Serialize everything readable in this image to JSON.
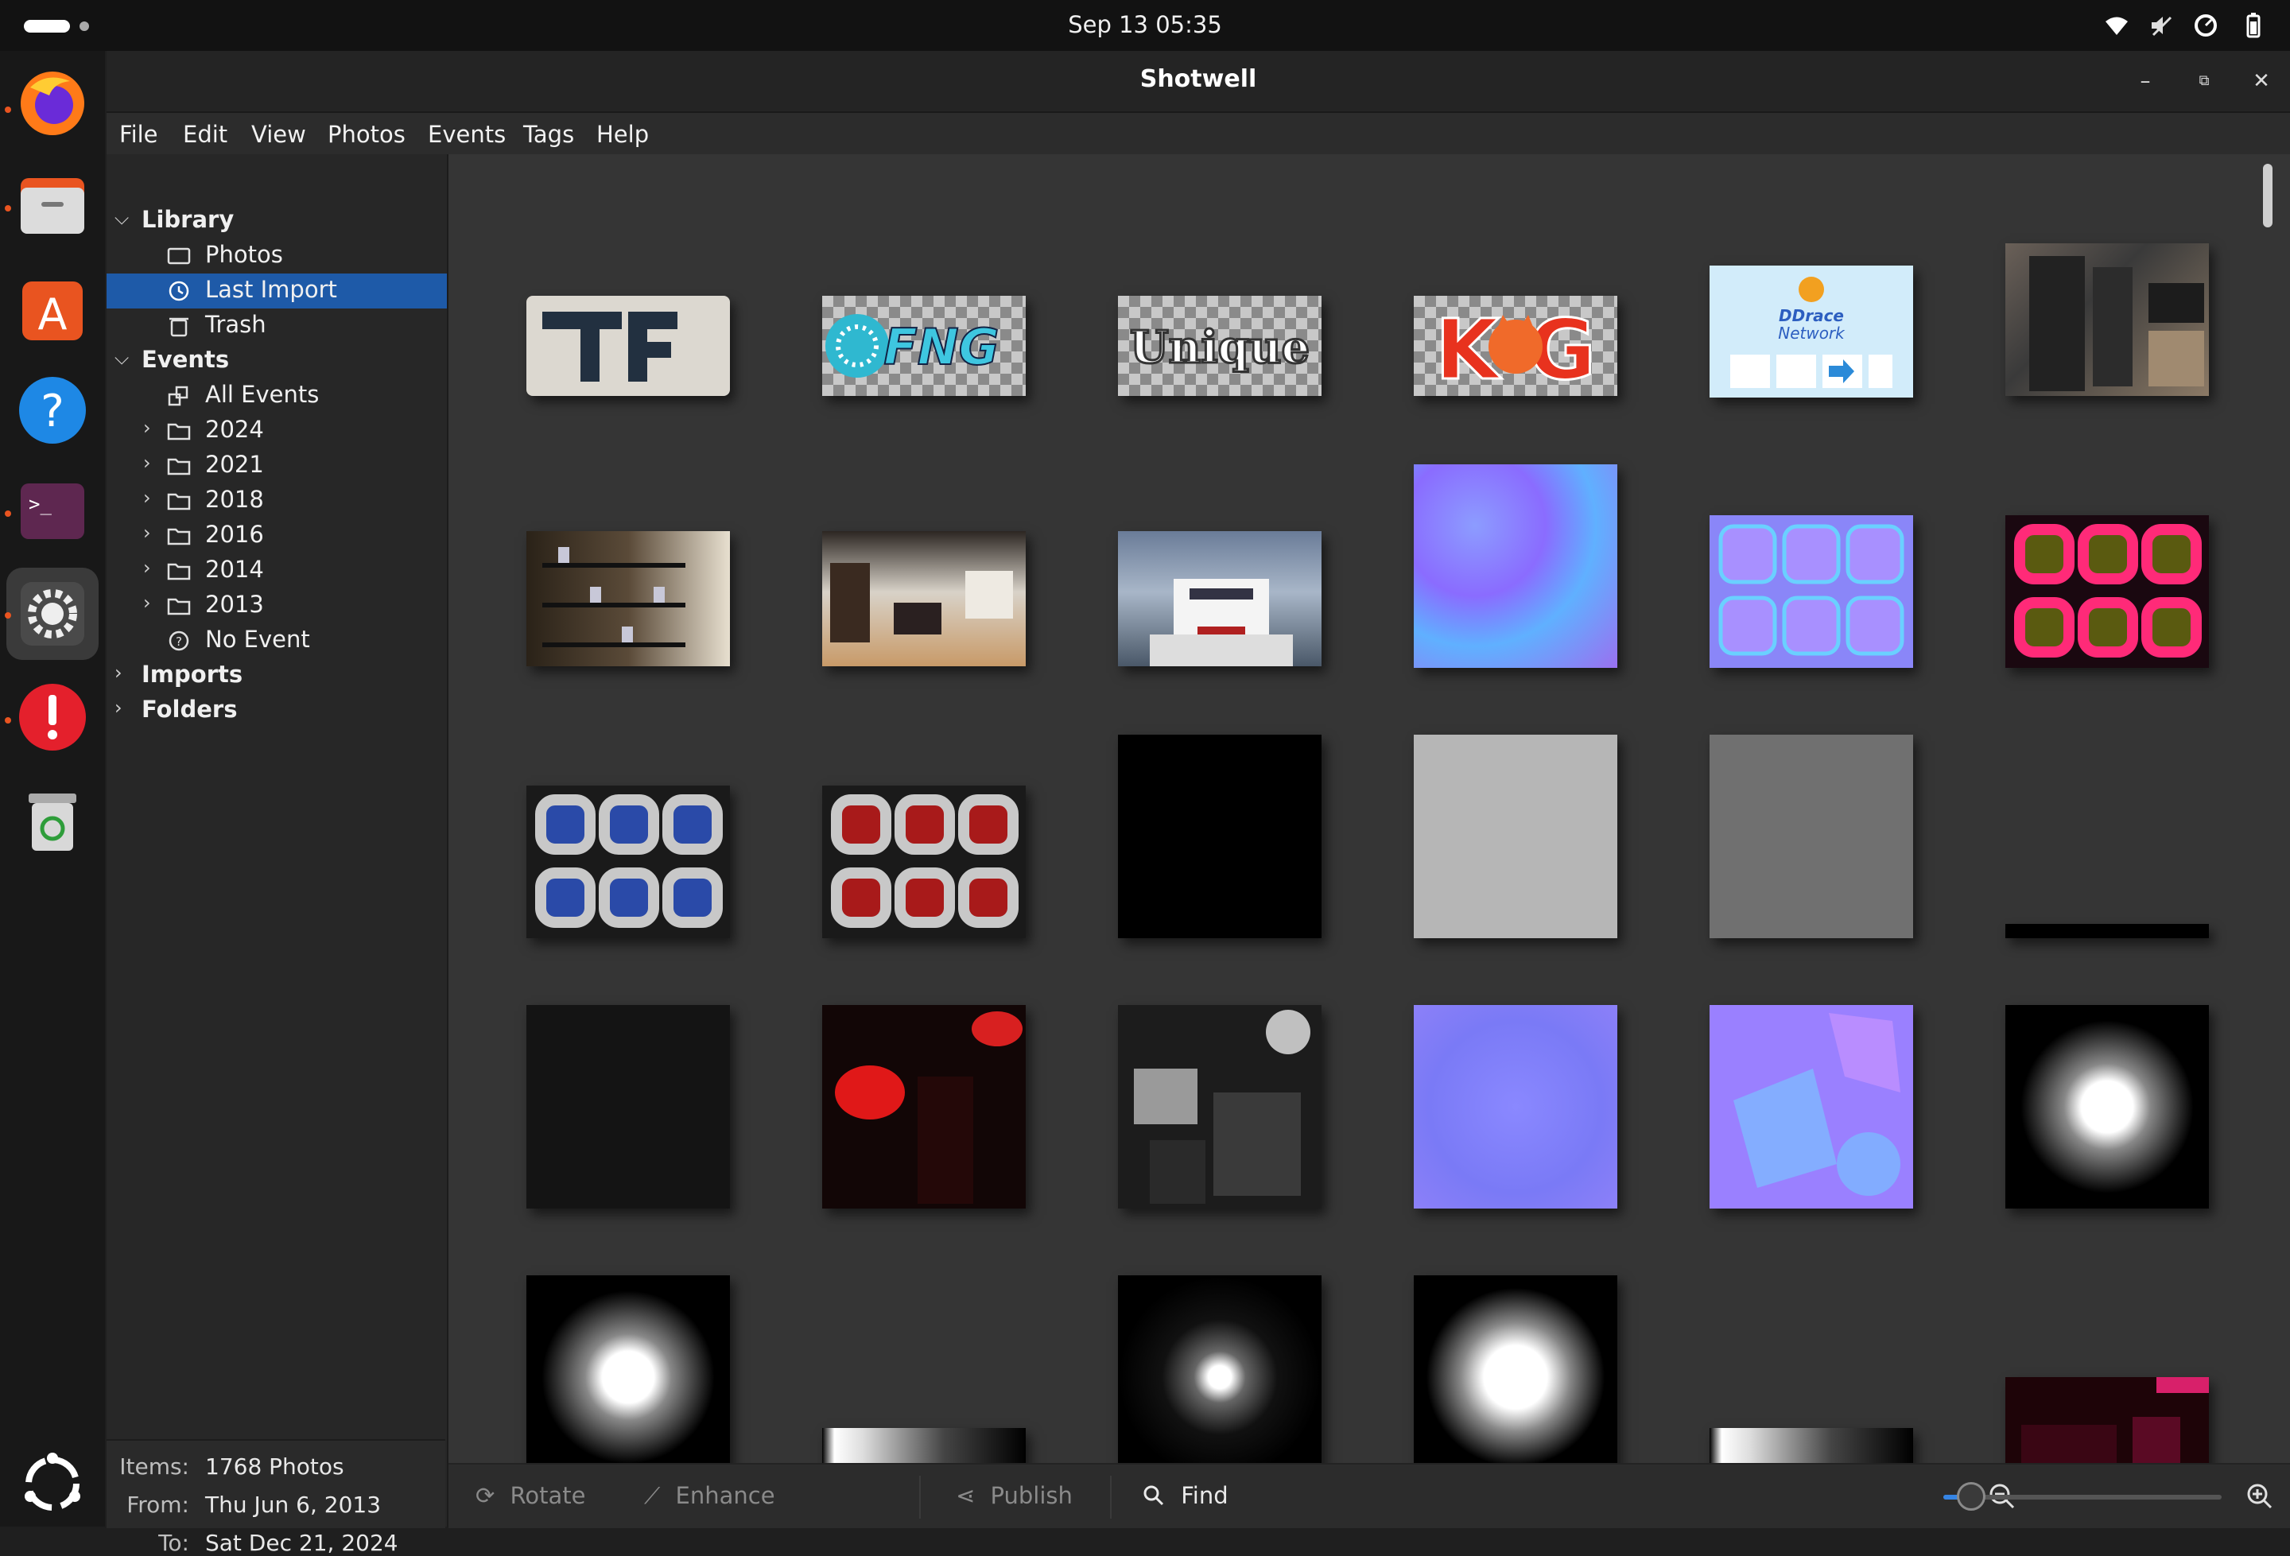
{
  "system": {
    "clock": "Sep 13  05:35",
    "tray_icons": [
      "wifi-icon",
      "volume-muted-icon",
      "power-profile-icon",
      "battery-icon"
    ]
  },
  "dock": {
    "items": [
      "firefox-icon",
      "files-icon",
      "app-center-icon",
      "help-icon",
      "terminal-icon",
      "settings-icon",
      "error-report-icon",
      "trash-icon",
      "show-apps-icon"
    ]
  },
  "window": {
    "title": "Shotwell",
    "controls": [
      "minimize-icon",
      "maximize-icon",
      "close-icon"
    ]
  },
  "menubar": [
    "File",
    "Edit",
    "View",
    "Photos",
    "Events",
    "Tags",
    "Help"
  ],
  "sidebar": {
    "library": {
      "label": "Library",
      "items": [
        {
          "label": "Photos",
          "icon": "photos-icon"
        },
        {
          "label": "Last Import",
          "icon": "last-import-icon",
          "selected": true
        },
        {
          "label": "Trash",
          "icon": "trash-icon"
        }
      ]
    },
    "events": {
      "label": "Events",
      "items": [
        {
          "label": "All Events",
          "icon": "all-events-icon"
        },
        {
          "label": "2024",
          "icon": "folder-icon"
        },
        {
          "label": "2021",
          "icon": "folder-icon"
        },
        {
          "label": "2018",
          "icon": "folder-icon"
        },
        {
          "label": "2016",
          "icon": "folder-icon"
        },
        {
          "label": "2014",
          "icon": "folder-icon"
        },
        {
          "label": "2013",
          "icon": "folder-icon"
        },
        {
          "label": "No Event",
          "icon": "no-event-icon"
        }
      ]
    },
    "imports_label": "Imports",
    "folders_label": "Folders"
  },
  "info": {
    "items_label": "Items:",
    "items_value": "1768 Photos",
    "from_label": "From:",
    "from_value": "Thu Jun 6, 2013",
    "to_label": "To:",
    "to_value": "Sat Dec 21, 2024"
  },
  "toolbar": {
    "rotate": "Rotate",
    "enhance": "Enhance",
    "publish": "Publish",
    "find": "Find",
    "zoom_level": 0.1
  },
  "thumbnails": [
    {
      "name": "thumb-tf-logo",
      "kind": "logo-f"
    },
    {
      "name": "thumb-fng-logo",
      "kind": "logo-fng"
    },
    {
      "name": "thumb-unique-logo",
      "kind": "logo-unique"
    },
    {
      "name": "thumb-kog-logo",
      "kind": "logo-kog"
    },
    {
      "name": "thumb-ddrace-network",
      "kind": "logo-ddnet"
    },
    {
      "name": "thumb-server-room",
      "kind": "photo-server"
    },
    {
      "name": "thumb-shelves-photo",
      "kind": "photo-shelves"
    },
    {
      "name": "thumb-room-photo",
      "kind": "photo-room"
    },
    {
      "name": "thumb-boat-photo",
      "kind": "photo-boat"
    },
    {
      "name": "thumb-normal-map-1",
      "kind": "normal-map"
    },
    {
      "name": "thumb-normal-buttons",
      "kind": "normal-buttons"
    },
    {
      "name": "thumb-pink-buttons",
      "kind": "pink-buttons"
    },
    {
      "name": "thumb-blue-buttons",
      "kind": "blue-buttons"
    },
    {
      "name": "thumb-red-buttons",
      "kind": "red-buttons"
    },
    {
      "name": "thumb-black-square",
      "kind": "black"
    },
    {
      "name": "thumb-light-gray-square",
      "kind": "light-gray"
    },
    {
      "name": "thumb-gray-square",
      "kind": "gray"
    },
    {
      "name": "thumb-thin-black-strip",
      "kind": "strip"
    },
    {
      "name": "thumb-dark-square",
      "kind": "dark"
    },
    {
      "name": "thumb-red-texture",
      "kind": "red-texture"
    },
    {
      "name": "thumb-gray-texture",
      "kind": "gray-texture"
    },
    {
      "name": "thumb-normal-map-2",
      "kind": "normal-map-2"
    },
    {
      "name": "thumb-normal-map-3",
      "kind": "normal-map-3"
    },
    {
      "name": "thumb-glow-star-1",
      "kind": "glow-star"
    },
    {
      "name": "thumb-glow-star-2",
      "kind": "glow-star"
    },
    {
      "name": "thumb-light-streak-1",
      "kind": "streak"
    },
    {
      "name": "thumb-small-glow",
      "kind": "small-glow"
    },
    {
      "name": "thumb-soft-glow",
      "kind": "soft-glow"
    },
    {
      "name": "thumb-light-streak-2",
      "kind": "streak"
    },
    {
      "name": "thumb-dark-red-texture",
      "kind": "dark-red"
    }
  ]
}
